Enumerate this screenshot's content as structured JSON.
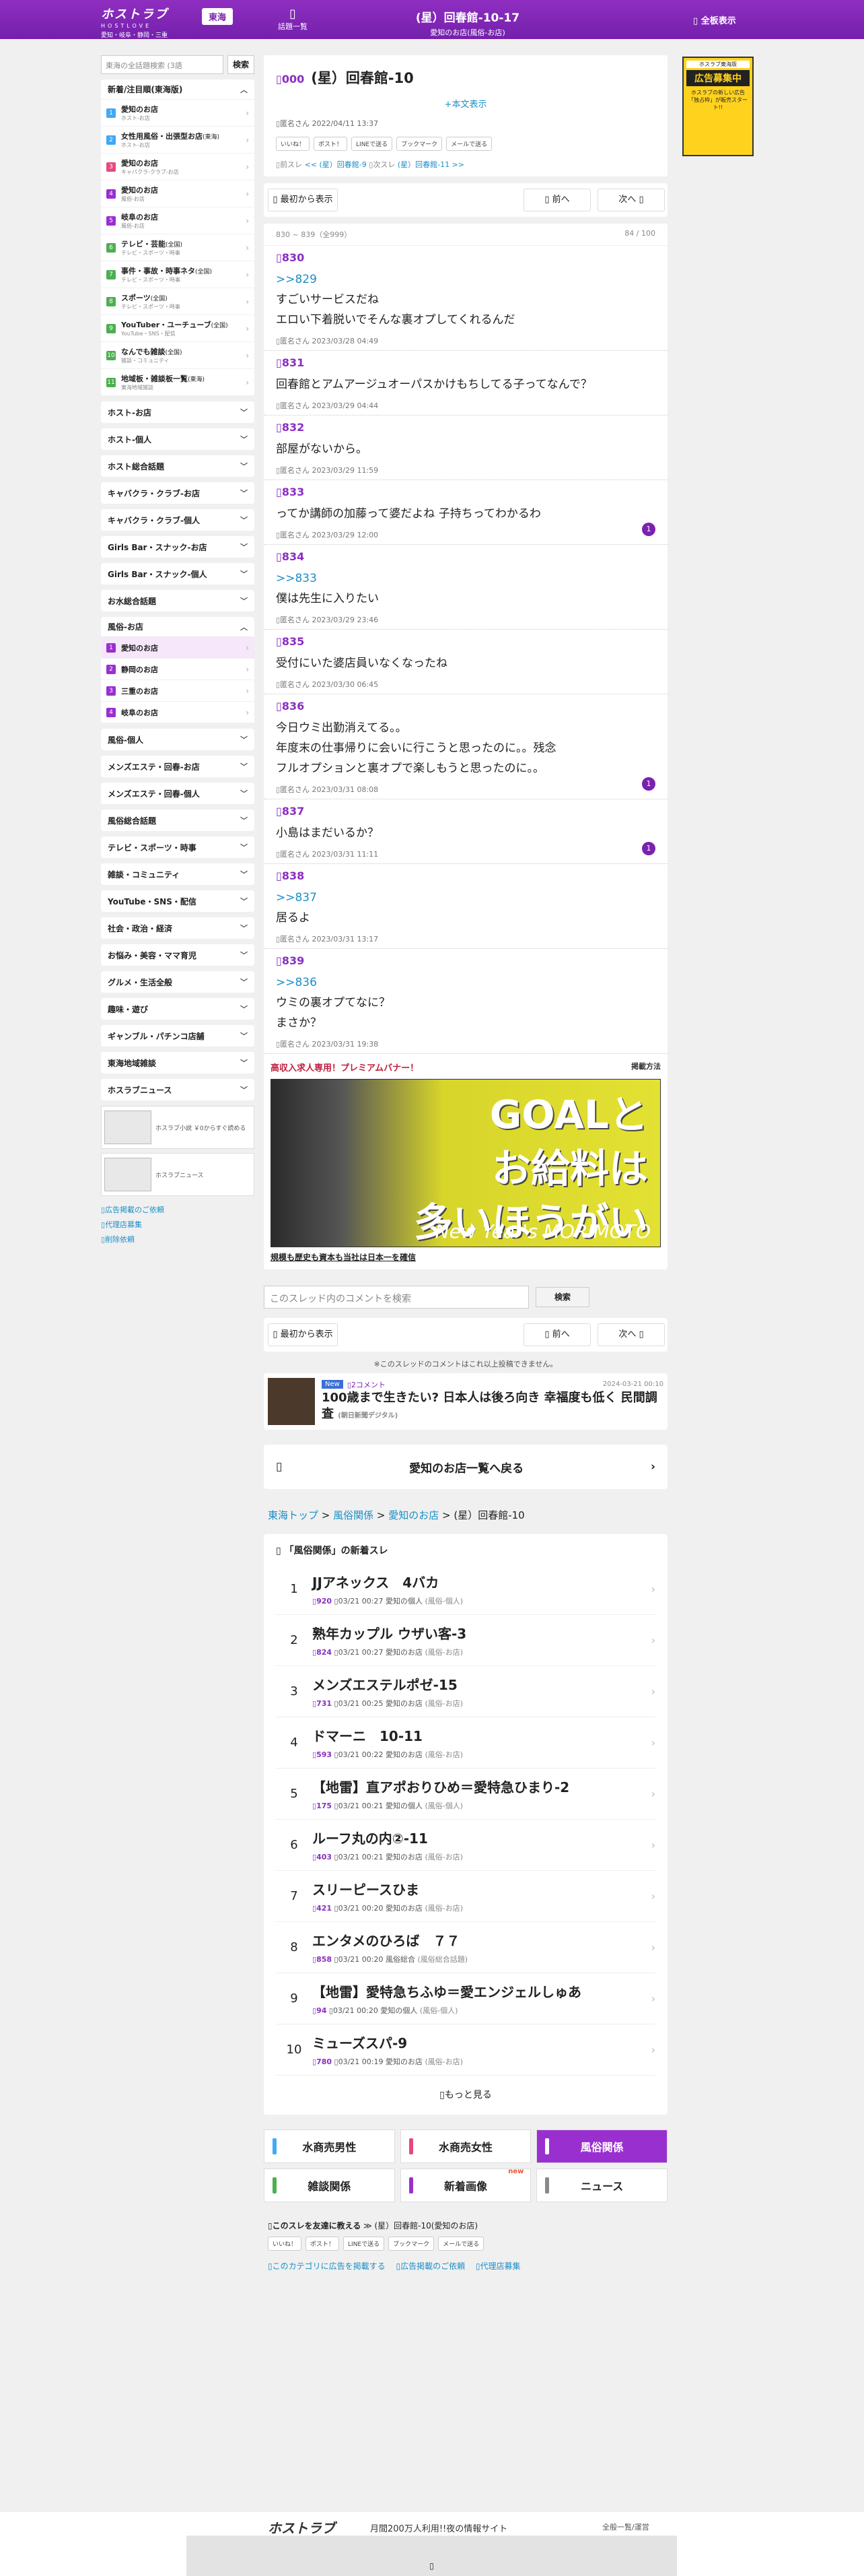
{
  "header": {
    "logo": "ホストラブ",
    "logo_en": "HOSTLOVE",
    "region_sub": "愛知・岐阜・静岡・三重",
    "region_btn": "東海",
    "threadlist": "話題一覧",
    "title": "(星）回春館-10-17",
    "subtitle": "愛知のお店(風俗-お店)",
    "fullview": "全板表示"
  },
  "sidebar": {
    "search_placeholder": "東海の全話題検索 (3語",
    "search_btn": "検索",
    "hot": {
      "title": "新着/注目順(東海版)",
      "items": [
        {
          "n": "1",
          "label": "愛知のお店",
          "sub": "ホスト-お店",
          "color": "#3fa9f5"
        },
        {
          "n": "2",
          "label": "女性用風俗・出張型お店",
          "tag": "(東海)",
          "sub": "ホスト-お店",
          "color": "#3fa9f5"
        },
        {
          "n": "3",
          "label": "愛知のお店",
          "sub": "キャバクラ-クラブ-お店",
          "color": "#e64a7a"
        },
        {
          "n": "4",
          "label": "愛知のお店",
          "sub": "風俗-お店",
          "color": "#9a2fd0"
        },
        {
          "n": "5",
          "label": "岐阜のお店",
          "sub": "風俗-お店",
          "color": "#9a2fd0"
        },
        {
          "n": "6",
          "label": "テレビ・芸能",
          "tag": "(全国)",
          "sub": "テレビ・スポーツ・時事",
          "color": "#4caf50"
        },
        {
          "n": "7",
          "label": "事件・事故・時事ネタ",
          "tag": "(全国)",
          "sub": "テレビ・スポーツ・時事",
          "color": "#4caf50"
        },
        {
          "n": "8",
          "label": "スポーツ",
          "tag": "(全国)",
          "sub": "テレビ・スポーツ・時事",
          "color": "#4caf50"
        },
        {
          "n": "9",
          "label": "YouTuber・ユーチューブ",
          "tag": "(全国)",
          "sub": "YouTube・SNS・配信",
          "color": "#4caf50"
        },
        {
          "n": "10",
          "label": "なんでも雑談",
          "tag": "(全国)",
          "sub": "雑談・コミュニティ",
          "color": "#4caf50"
        },
        {
          "n": "11",
          "label": "地域板・雑談板一覧",
          "tag": "(東海)",
          "sub": "東海地域雑談",
          "color": "#4caf50"
        }
      ]
    },
    "groups": [
      "ホスト-お店",
      "ホスト-個人",
      "ホスト総合話題",
      "キャバクラ・クラブ-お店",
      "キャバクラ・クラブ-個人",
      "Girls Bar・スナック-お店",
      "Girls Bar・スナック-個人",
      "お水総合話題"
    ],
    "fuzoku": {
      "title": "風俗-お店",
      "items": [
        {
          "n": "1",
          "label": "愛知のお店"
        },
        {
          "n": "2",
          "label": "静岡のお店"
        },
        {
          "n": "3",
          "label": "三重のお店"
        },
        {
          "n": "4",
          "label": "岐阜のお店"
        }
      ]
    },
    "groups2": [
      "風俗-個人",
      "メンズエステ・回春-お店",
      "メンズエステ・回春-個人",
      "風俗総合話題",
      "テレビ・スポーツ・時事",
      "雑談・コミュニティ",
      "YouTube・SNS・配信",
      "社会・政治・経済",
      "お悩み・美容・ママ育児",
      "グルメ・生活全般",
      "趣味・遊び",
      "ギャンブル・パチンコ店舗",
      "東海地域雑談",
      "ホスラブニュース"
    ],
    "banner1": "ホスラブ小説 ￥0からすぐ読める",
    "banner2": "ホスラブニュース",
    "links": [
      "広告掲載のご依頼",
      "代理店募集",
      "削除依頼"
    ]
  },
  "right_ad": {
    "l1": "ホスラブ東海版",
    "l2": "広告募集中",
    "l3": "ホスラブの新しい広告「独占枠」が販売スタート!!"
  },
  "op": {
    "no": "000",
    "title": "(星）回春館-10",
    "expand": "+本文表示",
    "author": "匿名さん",
    "date": "2022/04/11 13:37",
    "shares": [
      "いいね！",
      "ポスト！",
      "LINEで送る",
      "ブックマーク",
      "メールで送る"
    ],
    "prev_label": "前スレ",
    "prev": "(星）回春館-9",
    "next_label": "次スレ",
    "next": "(星）回春館-11"
  },
  "nav": {
    "first": "最初から表示",
    "prev": "前へ",
    "next": "次へ"
  },
  "pager": {
    "range": "830 ~ 839（全999）",
    "page": "84 / 100"
  },
  "responses": [
    {
      "no": "830",
      "anchor": "",
      "lines": [
        "すごいサービスだね",
        "エロい下着脱いでそんな裏オプしてくれるんだ"
      ],
      "anchor2": ">>829",
      "meta": "匿名さん 2023/03/28 04:49",
      "badge": ""
    },
    {
      "no": "831",
      "anchor2": "",
      "lines": [
        "回春館とアムアージュオーパスかけもちしてる子ってなんで？"
      ],
      "meta": "匿名さん 2023/03/29 04:44",
      "badge": ""
    },
    {
      "no": "832",
      "anchor2": "",
      "lines": [
        "部屋がないから。"
      ],
      "meta": "匿名さん 2023/03/29 11:59",
      "badge": ""
    },
    {
      "no": "833",
      "anchor2": "",
      "lines": [
        "ってか講師の加藤って婆だよね 子持ちってわかるわ"
      ],
      "meta": "匿名さん 2023/03/29 12:00",
      "badge": "1"
    },
    {
      "no": "834",
      "anchor2": ">>833",
      "lines": [
        "僕は先生に入りたい"
      ],
      "meta": "匿名さん 2023/03/29 23:46",
      "badge": ""
    },
    {
      "no": "835",
      "anchor2": "",
      "lines": [
        "受付にいた婆店員いなくなったね"
      ],
      "meta": "匿名さん 2023/03/30 06:45",
      "badge": ""
    },
    {
      "no": "836",
      "anchor2": "",
      "lines": [
        "今日ウミ出勤消えてる。。",
        "年度末の仕事帰りに会いに行こうと思ったのに。。残念",
        "フルオプションと裏オプで楽しもうと思ったのに。。"
      ],
      "meta": "匿名さん 2023/03/31 08:08",
      "badge": "1"
    },
    {
      "no": "837",
      "anchor2": "",
      "lines": [
        "小島はまだいるか？"
      ],
      "meta": "匿名さん 2023/03/31 11:11",
      "badge": "1"
    },
    {
      "no": "838",
      "anchor2": ">>837",
      "lines": [
        "居るよ"
      ],
      "meta": "匿名さん 2023/03/31 13:17",
      "badge": ""
    },
    {
      "no": "839",
      "anchor2": ">>836",
      "lines": [
        "ウミの裏オプてなに？",
        "まさか？"
      ],
      "meta": "匿名さん 2023/03/31 19:38",
      "badge": ""
    }
  ],
  "premium": {
    "head": "高収入求人専用！プレミアムバナー！",
    "how": "掲載方法",
    "img_l1": "GOALと",
    "img_l2": "お給料は",
    "img_l3": "多いほうがいい",
    "brand": "New Year's MORIMOTO",
    "caption": "規模も歴史も資本も当社は日本一を確信"
  },
  "thread_search": {
    "placeholder": "このスレッド内のコメントを検索",
    "btn": "検索"
  },
  "closed_note": "※このスレッドのコメントはこれ以上投稿できません。",
  "article": {
    "tag": "New",
    "comments": "2コメント",
    "date": "2024-03-21 00:10",
    "headline": "100歳まで生きたい? 日本人は後ろ向き 幸福度も低く 民間調査",
    "source": "(朝日新聞デジタル)"
  },
  "back": "愛知のお店一覧へ戻る",
  "breadcrumb": [
    "東海トップ",
    "風俗関係",
    "愛知のお店",
    "(星）回春館-10"
  ],
  "newthreads": {
    "head": "「風俗関係」の新着スレ",
    "rows": [
      {
        "rk": "1",
        "title": "JJアネックス　4バカ",
        "cnt": "920",
        "date": "03/21 00:27",
        "board": "愛知の個人",
        "cat": "(風俗-個人)"
      },
      {
        "rk": "2",
        "title": "熟年カップル ウザい客-3",
        "cnt": "824",
        "date": "03/21 00:27",
        "board": "愛知のお店",
        "cat": "(風俗-お店)"
      },
      {
        "rk": "3",
        "title": "メンズエステルポゼ-15",
        "cnt": "731",
        "date": "03/21 00:25",
        "board": "愛知のお店",
        "cat": "(風俗-お店)"
      },
      {
        "rk": "4",
        "title": "ドマーニ　10-11",
        "cnt": "593",
        "date": "03/21 00:22",
        "board": "愛知のお店",
        "cat": "(風俗-お店)"
      },
      {
        "rk": "5",
        "title": "【地雷】直アポおりひめ＝愛特急ひまり-2",
        "cnt": "175",
        "date": "03/21 00:21",
        "board": "愛知の個人",
        "cat": "(風俗-個人)"
      },
      {
        "rk": "6",
        "title": "ルーフ丸の内②-11",
        "cnt": "403",
        "date": "03/21 00:21",
        "board": "愛知のお店",
        "cat": "(風俗-お店)"
      },
      {
        "rk": "7",
        "title": "スリーピースひま",
        "cnt": "421",
        "date": "03/21 00:20",
        "board": "愛知のお店",
        "cat": "(風俗-お店)"
      },
      {
        "rk": "8",
        "title": "エンタメのひろば　７７",
        "cnt": "858",
        "date": "03/21 00:20",
        "board": "風俗総合",
        "cat": "(風俗総合話題)"
      },
      {
        "rk": "9",
        "title": "【地雷】愛特急ちふゆ＝愛エンジェルしゅあ",
        "cnt": "94",
        "date": "03/21 00:20",
        "board": "愛知の個人",
        "cat": "(風俗-個人)"
      },
      {
        "rk": "10",
        "title": "ミューズスパ-9",
        "cnt": "780",
        "date": "03/21 00:19",
        "board": "愛知のお店",
        "cat": "(風俗-お店)"
      }
    ],
    "more": "もっと見る"
  },
  "catgrid": [
    {
      "label": "水商売男性",
      "color": "#3fa9f5",
      "new": ""
    },
    {
      "label": "水商売女性",
      "color": "#e64a7a",
      "new": ""
    },
    {
      "label": "風俗関係",
      "color": "#ffffff",
      "new": "",
      "active": true
    },
    {
      "label": "雑談関係",
      "color": "#4caf50",
      "new": ""
    },
    {
      "label": "新着画像",
      "color": "#9a2fd0",
      "new": "new"
    },
    {
      "label": "ニュース",
      "color": "#888888",
      "new": ""
    }
  ],
  "share": {
    "title": "このスレを友達に教える",
    "thread": "(星）回春館-10(愛知のお店)",
    "links": [
      "このカテゴリに広告を掲載する",
      "広告掲載のご依頼",
      "代理店募集"
    ]
  },
  "footer": {
    "logo": "ホストラブ",
    "tag": "月間200万人利用!!夜の情報サイト",
    "right": "全般一覧/運営"
  }
}
